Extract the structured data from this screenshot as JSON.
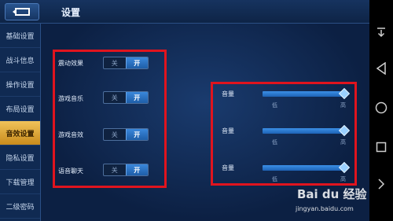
{
  "header": {
    "title": "设置"
  },
  "sidebar": {
    "items": [
      {
        "label": "基础设置",
        "active": false
      },
      {
        "label": "战斗信息",
        "active": false
      },
      {
        "label": "操作设置",
        "active": false
      },
      {
        "label": "布局设置",
        "active": false
      },
      {
        "label": "音效设置",
        "active": true
      },
      {
        "label": "隐私设置",
        "active": false
      },
      {
        "label": "下载管理",
        "active": false
      },
      {
        "label": "二级密码",
        "active": false
      }
    ]
  },
  "toggles": [
    {
      "label": "震动效果",
      "off": "关",
      "on": "开",
      "state": "on"
    },
    {
      "label": "游戏音乐",
      "off": "关",
      "on": "开",
      "state": "on"
    },
    {
      "label": "游戏音效",
      "off": "关",
      "on": "开",
      "state": "on"
    },
    {
      "label": "语音聊天",
      "off": "关",
      "on": "开",
      "state": "on"
    }
  ],
  "volumes": [
    {
      "label": "音量",
      "low": "低",
      "high": "高",
      "level": 1.0
    },
    {
      "label": "音量",
      "low": "低",
      "high": "高",
      "level": 1.0
    },
    {
      "label": "音量",
      "low": "低",
      "high": "高",
      "level": 1.0
    }
  ],
  "watermark": {
    "brand": "Bai du 经验",
    "url": "jingyan.baidu.com"
  },
  "colors": {
    "highlight": "#e0141e",
    "accent": "#2f7ed3",
    "active_tab": "#e0a73a"
  }
}
